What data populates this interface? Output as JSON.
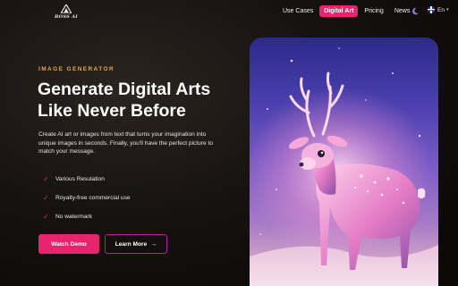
{
  "brand": {
    "logo_text": "BOSS AI"
  },
  "nav": {
    "items": [
      {
        "label": "Use Cases",
        "active": false
      },
      {
        "label": "Digital Art",
        "active": true
      },
      {
        "label": "Pricing",
        "active": false
      },
      {
        "label": "News",
        "active": false
      }
    ],
    "theme_icon": "moon-icon",
    "language": "En",
    "language_flag": "uk-flag-icon"
  },
  "hero": {
    "eyebrow": "IMAGE GENERATOR",
    "title_line1": "Generate Digital Arts",
    "title_line2": "Like Never Before",
    "description": "Create AI art or images from text that turns your imagination into unique images in seconds. Finally, you'll have the perfect picture to match your message.",
    "features": [
      {
        "label": "Various Resulation",
        "icon": "check-icon"
      },
      {
        "label": "Royalty-free commercial use",
        "icon": "check-icon"
      },
      {
        "label": "No watermark",
        "icon": "check-icon"
      }
    ],
    "primary_button": "Watch Demo",
    "secondary_button": "Learn More",
    "secondary_button_icon": "arrow-right-icon"
  },
  "colors": {
    "accent": "#e8246f",
    "eyebrow": "#e7a64c",
    "background": "#161210"
  },
  "image": {
    "subject": "glowing-deer-illustration"
  }
}
